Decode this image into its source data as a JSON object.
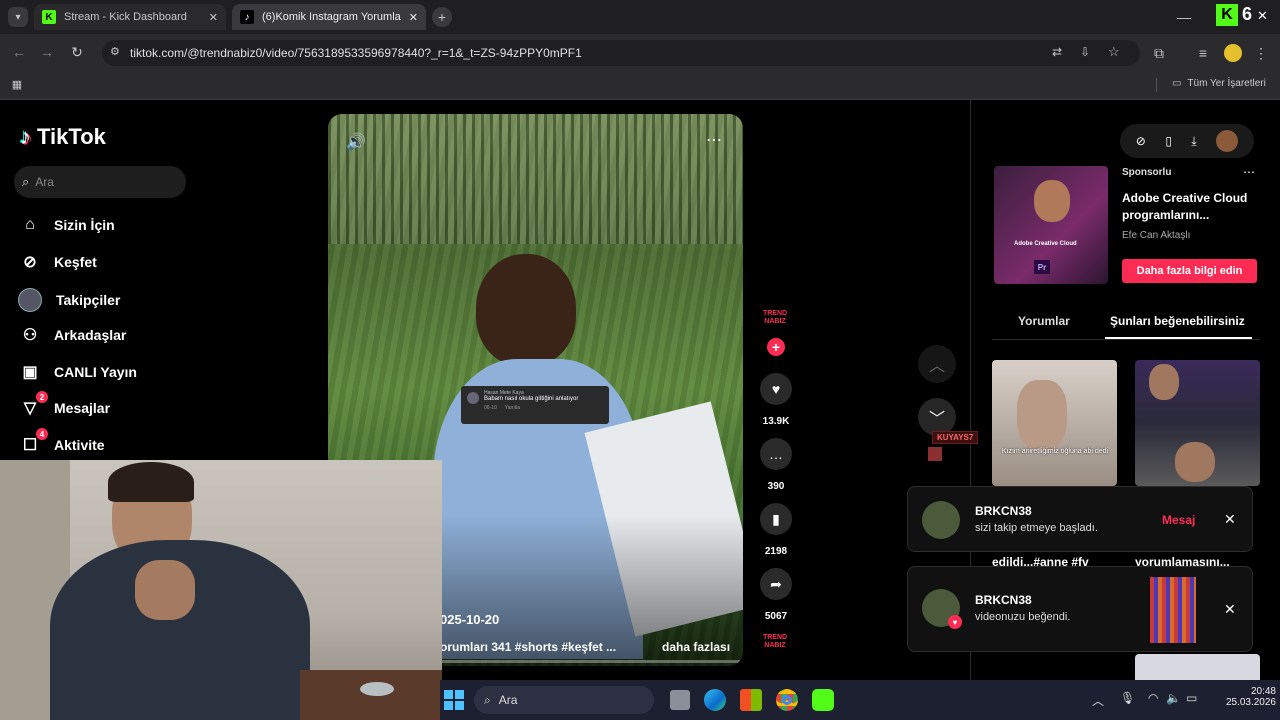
{
  "browser": {
    "tabs": [
      {
        "label": "Stream - Kick Dashboard",
        "icon": "kick-icon",
        "active": false
      },
      {
        "label": "(6)Komik Instagram Yorumları v",
        "icon": "tiktok-icon",
        "active": true
      }
    ],
    "url": "tiktok.com/@trendnabiz0/video/7563189533596978440?_r=1&_t=ZS-94zPPY0mPF1",
    "bookmarks_label": "Tüm Yer İşaretleri",
    "kick_badge": "6",
    "kick_letter": "K"
  },
  "tiktok": {
    "logo": "TikTok",
    "search_placeholder": "Ara",
    "nav": [
      {
        "label": "Sizin İçin",
        "icon": "home-icon",
        "badge": ""
      },
      {
        "label": "Keşfet",
        "icon": "compass-icon",
        "badge": ""
      },
      {
        "label": "Takipçiler",
        "icon": "avatar-icon",
        "badge": ""
      },
      {
        "label": "Arkadaşlar",
        "icon": "friends-icon",
        "badge": ""
      },
      {
        "label": "CANLI Yayın",
        "icon": "live-icon",
        "badge": ""
      },
      {
        "label": "Mesajlar",
        "icon": "message-icon",
        "badge": "2"
      },
      {
        "label": "Aktivite",
        "icon": "activity-icon",
        "badge": "4"
      }
    ],
    "video": {
      "comment_user": "Hasan Mete Kaya",
      "comment_text": "Babam nasıl okula gittiğini anlatıyor",
      "comment_time": "06-10",
      "comment_reply": "Yanıtla",
      "date": "025-10-20",
      "caption": "orumları 341 #shorts #keşfet ...",
      "more": "daha fazlası"
    },
    "actions": {
      "channel_logo": "TREND NABIZ",
      "likes": "13.9K",
      "comments": "390",
      "saves": "2198",
      "shares": "5067"
    },
    "ad": {
      "sponsored": "Sponsorlu",
      "title": "Adobe Creative Cloud programlarını...",
      "author": "Efe Can Aktaşlı",
      "cta": "Daha fazla bilgi edin",
      "thumb_caption": "Adobe Creative Cloud",
      "thumb_badge": "Pr"
    },
    "tabs": [
      "Yorumlar",
      "Şunları beğenebilirsiniz"
    ],
    "suggestions": [
      {
        "caption": "Kızım aniretliğimiz oğluna abi dedi",
        "title": "edildi...#anne #fv"
      },
      {
        "caption": "",
        "title": "yorumlamasını..."
      }
    ],
    "overlay_tag": "KUYAYS7",
    "notifications": [
      {
        "user": "BRKCN38",
        "text": "sizi takip etmeye başladı.",
        "action": "Mesaj"
      },
      {
        "user": "BRKCN38",
        "text": "videonuzu beğendi.",
        "action": ""
      }
    ]
  },
  "taskbar": {
    "search": "Ara",
    "time": "20:48",
    "date": "25.03.2026"
  },
  "colors": {
    "accent": "#fe2c55",
    "kick": "#53fc18"
  }
}
